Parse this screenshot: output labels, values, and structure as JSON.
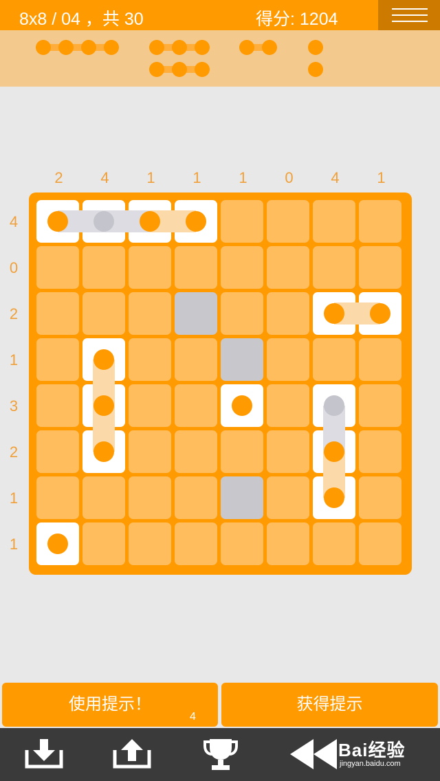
{
  "header": {
    "puzzle_label": "8x8 / 04 ，共 30",
    "score_label": "得分: 1204"
  },
  "legend": {
    "ships": [
      4,
      3,
      3,
      2,
      1,
      1
    ]
  },
  "board": {
    "size": 8,
    "column_clues": [
      "2",
      "4",
      "1",
      "1",
      "1",
      "0",
      "4",
      "1"
    ],
    "row_clues": [
      "4",
      "0",
      "2",
      "1",
      "3",
      "2",
      "1",
      "1"
    ],
    "cells": [
      [
        "ship",
        "ship",
        "ship",
        "ship",
        "empty",
        "empty",
        "empty",
        "empty"
      ],
      [
        "empty",
        "empty",
        "empty",
        "empty",
        "empty",
        "empty",
        "empty",
        "empty"
      ],
      [
        "empty",
        "empty",
        "empty",
        "water",
        "empty",
        "empty",
        "ship",
        "ship"
      ],
      [
        "empty",
        "ship",
        "empty",
        "empty",
        "water",
        "empty",
        "empty",
        "empty"
      ],
      [
        "empty",
        "ship",
        "empty",
        "empty",
        "ship",
        "empty",
        "ship",
        "empty"
      ],
      [
        "empty",
        "ship",
        "empty",
        "empty",
        "empty",
        "empty",
        "ship",
        "empty"
      ],
      [
        "empty",
        "empty",
        "empty",
        "empty",
        "water",
        "empty",
        "ship",
        "empty"
      ],
      [
        "ship",
        "empty",
        "empty",
        "empty",
        "empty",
        "empty",
        "empty",
        "empty"
      ]
    ],
    "grey_dots": [
      [
        0,
        1
      ],
      [
        4,
        6
      ]
    ],
    "ships": [
      {
        "cells": [
          [
            0,
            0
          ],
          [
            0,
            1
          ],
          [
            0,
            2
          ],
          [
            0,
            3
          ]
        ],
        "state": "partial"
      },
      {
        "cells": [
          [
            2,
            6
          ],
          [
            2,
            7
          ]
        ],
        "state": "complete"
      },
      {
        "cells": [
          [
            3,
            1
          ],
          [
            4,
            1
          ],
          [
            5,
            1
          ]
        ],
        "state": "complete"
      },
      {
        "cells": [
          [
            4,
            4
          ]
        ],
        "state": "complete"
      },
      {
        "cells": [
          [
            4,
            6
          ],
          [
            5,
            6
          ],
          [
            6,
            6
          ]
        ],
        "state": "partial"
      },
      {
        "cells": [
          [
            7,
            0
          ]
        ],
        "state": "complete"
      }
    ]
  },
  "buttons": {
    "use_hint": "使用提示！",
    "hint_count": "4",
    "get_hint": "获得提示"
  },
  "toolbar": {
    "icons": [
      "download-icon",
      "upload-icon",
      "trophy-icon",
      "rewind-icon"
    ]
  },
  "watermark": {
    "brand": "Bai经验",
    "url": "jingyan.baidu.com"
  },
  "colors": {
    "accent": "#ff9a00",
    "empty_cell": "#ffbd5e",
    "water_cell": "#c8c8cc",
    "ship_cell": "#ffffff",
    "legend_bg": "#f4c98e",
    "background": "#e8e8e8",
    "toolbar_bg": "#3a3a3a"
  }
}
